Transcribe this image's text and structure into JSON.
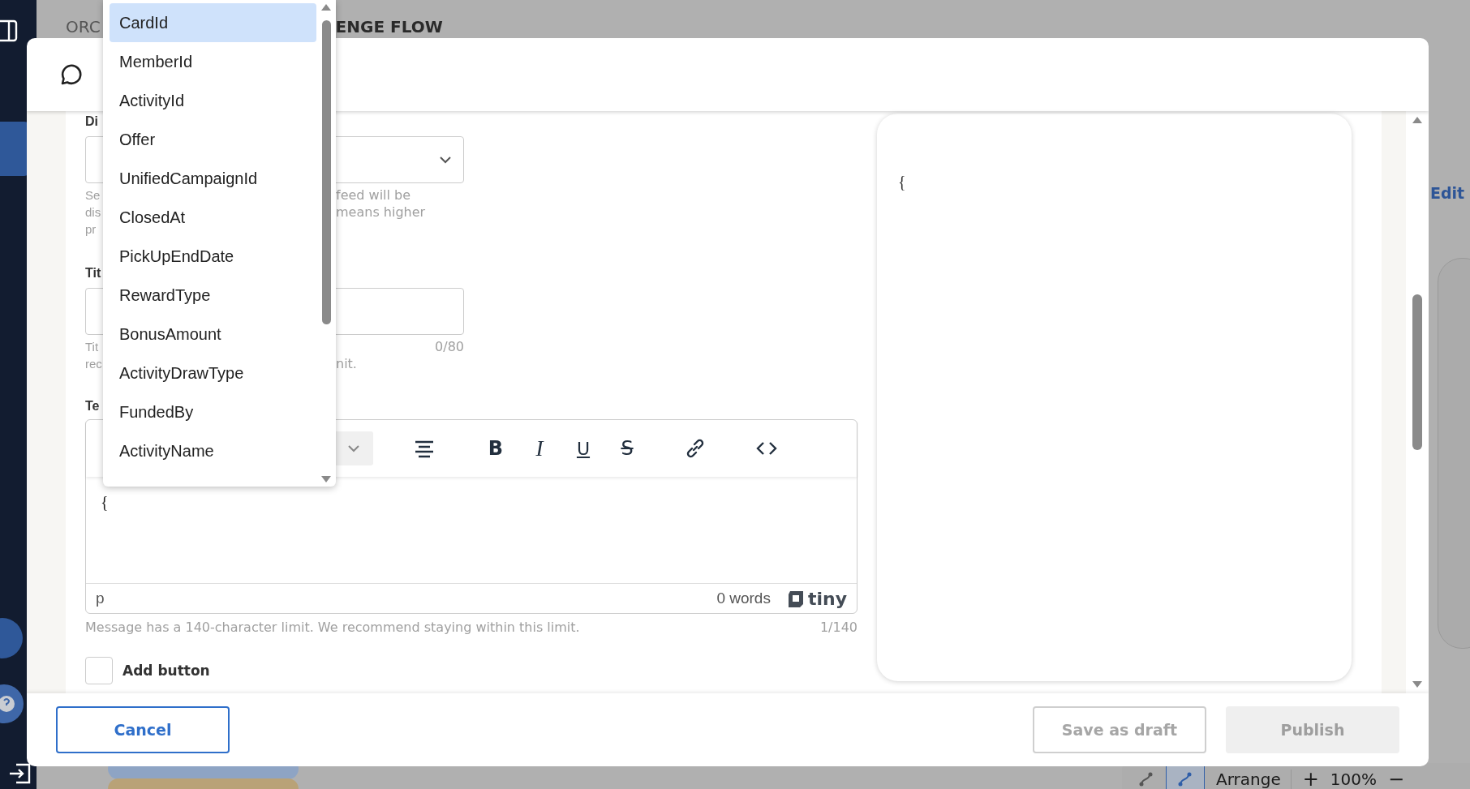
{
  "background": {
    "title_left": "ORC",
    "title_right": "ENGE FLOW",
    "edit_link": "Edit",
    "toolbar": {
      "arrange": "Arrange",
      "zoom_in": "+",
      "zoom": "100%",
      "zoom_out": "−"
    }
  },
  "modal": {
    "fields": [
      {
        "kind": "select",
        "label": "Di",
        "hint_left": [
          "Se",
          "dis",
          "pr"
        ],
        "hint_right": [
          "feed will be",
          "means higher"
        ]
      },
      {
        "kind": "input",
        "label": "Tit",
        "counter": "0/80",
        "hint_left": [
          "Tit",
          "rec"
        ],
        "hint_right": [
          "nit."
        ]
      }
    ],
    "editor": {
      "label": "Te",
      "toolbar": [
        {
          "kind": "align"
        },
        {
          "kind": "bold",
          "glyph": "B"
        },
        {
          "kind": "italic",
          "glyph": "I"
        },
        {
          "kind": "underline",
          "glyph": "U"
        },
        {
          "kind": "strike",
          "glyph": "S"
        },
        {
          "kind": "link"
        },
        {
          "kind": "code"
        }
      ],
      "content": "{",
      "element_path": "p",
      "word_count": "0 words",
      "brand": "tiny"
    },
    "message_hint": "Message has a 140-character limit. We recommend staying within this limit.",
    "message_counter": "1/140",
    "add_button": {
      "label": "Add button",
      "checked": false
    },
    "preview": {
      "content": "{"
    },
    "buttons": [
      {
        "kind": "cancel",
        "label": "Cancel",
        "disabled": false
      },
      {
        "kind": "draft",
        "label": "Save as draft",
        "disabled": true
      },
      {
        "kind": "publish",
        "label": "Publish",
        "disabled": true
      }
    ]
  },
  "dropdown": {
    "items": [
      {
        "label": "CardId",
        "selected": true
      },
      {
        "label": "MemberId",
        "selected": false
      },
      {
        "label": "ActivityId",
        "selected": false
      },
      {
        "label": "Offer",
        "selected": false
      },
      {
        "label": "UnifiedCampaignId",
        "selected": false
      },
      {
        "label": "ClosedAt",
        "selected": false
      },
      {
        "label": "PickUpEndDate",
        "selected": false
      },
      {
        "label": "RewardType",
        "selected": false
      },
      {
        "label": "BonusAmount",
        "selected": false
      },
      {
        "label": "ActivityDrawType",
        "selected": false
      },
      {
        "label": "FundedBy",
        "selected": false
      },
      {
        "label": "ActivityName",
        "selected": false
      }
    ]
  }
}
